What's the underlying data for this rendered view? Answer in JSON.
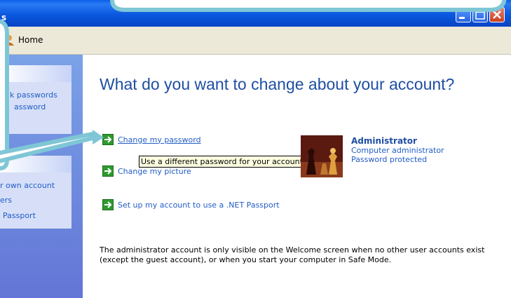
{
  "window": {
    "title_fragment": "s",
    "colors": {
      "title_bar": "#0a58e0",
      "toolbar": "#ece9d8",
      "task_pane": "#6f8ee0",
      "link": "#215dc6",
      "heading": "#1f4ea3",
      "callout": "#7fc6d6"
    }
  },
  "toolbar": {
    "home_label": "Home"
  },
  "left_pane": {
    "box1": {
      "items": [
        "k passwords",
        "assword"
      ]
    },
    "box2": {
      "items": [
        "r own account",
        "ers",
        "Passport"
      ]
    }
  },
  "main": {
    "heading": "What do you want to change about your account?",
    "tasks": [
      {
        "label": "Change my password",
        "icon": "green-arrow-icon"
      },
      {
        "label": "Change my picture",
        "icon": "green-arrow-icon"
      },
      {
        "label": "Set up my account to use a .NET Passport",
        "icon": "green-arrow-icon"
      }
    ],
    "tooltip": "Use a different password for your account.",
    "user": {
      "name": "Administrator",
      "role": "Computer administrator",
      "status": "Password protected",
      "picture": "chess-pieces-picture"
    },
    "note": "The administrator account is only visible on the Welcome screen when no other user accounts exist (except the guest account), or when you start your computer in Safe Mode."
  }
}
